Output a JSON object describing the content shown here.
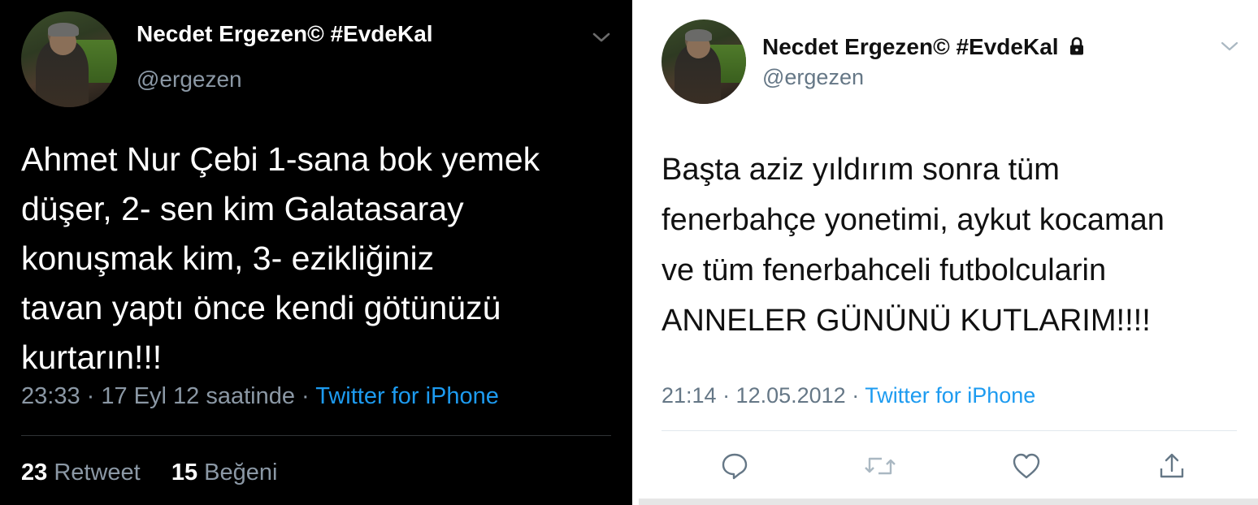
{
  "left_tweet": {
    "display_name": "Necdet Ergezen© #EvdeKal",
    "handle": "@ergezen",
    "text_lines": [
      "Ahmet Nur Çebi 1-sana bok yemek",
      "düşer, 2- sen kim Galatasaray",
      "konuşmak kim, 3- ezikliğiniz",
      "tavan yaptı önce kendi götünüzü",
      "kurtarın!!!"
    ],
    "meta_time": "23:33 · 17 Eyl 12 saatinde ·",
    "source": "Twitter for iPhone",
    "retweet_count": "23",
    "retweet_label": "Retweet",
    "like_count": "15",
    "like_label": "Beğeni",
    "icons": {
      "avatar": "avatar-photo",
      "menu": "chevron-down-icon"
    }
  },
  "right_tweet": {
    "display_name": "Necdet Ergezen© #EvdeKal",
    "handle": "@ergezen",
    "protected_icon": "lock-icon",
    "text_lines": [
      "Başta aziz yıldırım sonra tüm",
      "fenerbahçe yonetimi, aykut kocaman",
      "ve tüm fenerbahceli futbolcularin",
      "ANNELER GÜNÜNÜ KUTLARIM!!!!"
    ],
    "meta_time": "21:14 · 12.05.2012 ·",
    "source": "Twitter for iPhone",
    "actions": [
      "reply-icon",
      "retweet-icon",
      "like-icon",
      "share-icon"
    ]
  },
  "colors": {
    "link_blue": "#1d9bf0",
    "dark_bg": "#000000",
    "dark_secondary_text": "#8b98a5",
    "light_secondary_text": "#657786"
  }
}
